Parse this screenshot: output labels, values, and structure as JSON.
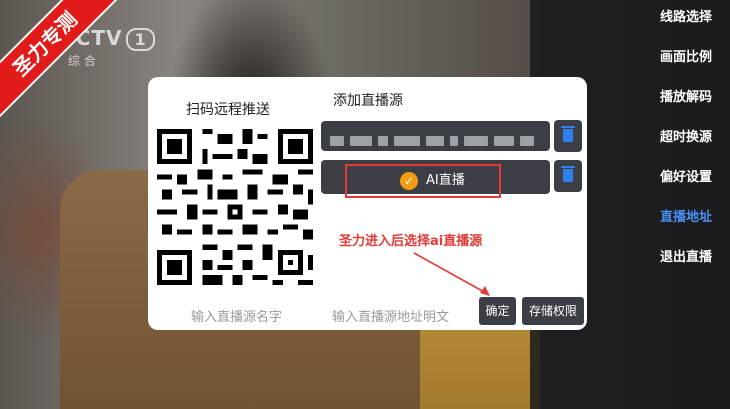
{
  "watermark": {
    "ribbon_text": "圣力专测"
  },
  "channel": {
    "logo_text": "CCTV",
    "number": "1",
    "subtitle": "综 合"
  },
  "side_menu": {
    "items": [
      {
        "label": "线路选择",
        "active": false
      },
      {
        "label": "画面比例",
        "active": false
      },
      {
        "label": "播放解码",
        "active": false
      },
      {
        "label": "超时换源",
        "active": false
      },
      {
        "label": "偏好设置",
        "active": false
      },
      {
        "label": "直播地址",
        "active": true
      },
      {
        "label": "退出直播",
        "active": false
      }
    ]
  },
  "dialog": {
    "qr_title": "扫码远程推送",
    "add_title": "添加直播源",
    "sources": [
      {
        "label": "",
        "masked": true
      },
      {
        "label": "AI直播",
        "selected": true
      }
    ],
    "annotation": "圣力进入后选择ai直播源",
    "name_placeholder": "输入直播源名字",
    "url_placeholder": "输入直播源地址明文",
    "confirm_label": "确定",
    "storage_label": "存储权限"
  },
  "colors": {
    "accent": "#4a8ef0",
    "annotation": "#e53935",
    "check": "#f39c12",
    "watermark": "#e11a1a"
  }
}
